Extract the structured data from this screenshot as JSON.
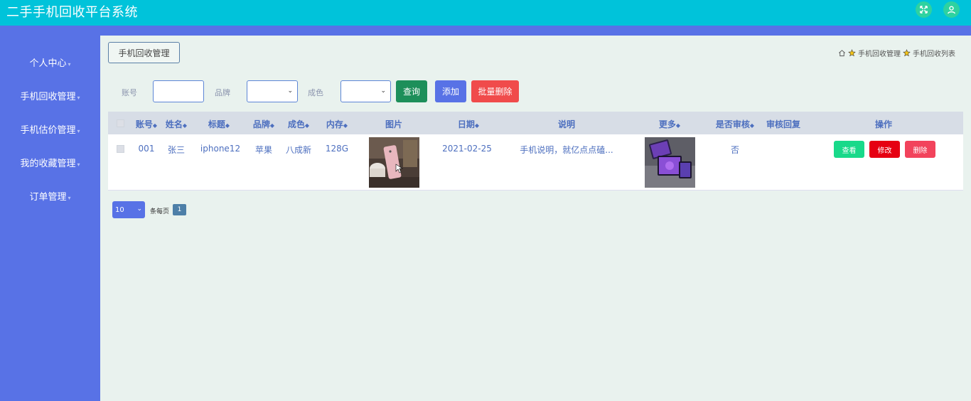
{
  "app": {
    "title": "二手手机回收平台系统"
  },
  "sidebar": {
    "items": [
      {
        "label": "个人中心"
      },
      {
        "label": "手机回收管理"
      },
      {
        "label": "手机估价管理"
      },
      {
        "label": "我的收藏管理"
      },
      {
        "label": "订单管理"
      }
    ]
  },
  "header": {
    "module_tag": "手机回收管理",
    "breadcrumb": [
      "手机回收管理",
      "手机回收列表"
    ]
  },
  "filters": {
    "account_label": "账号",
    "brand_label": "品牌",
    "condition_label": "成色",
    "account_value": "",
    "brand_value": "",
    "condition_value": ""
  },
  "actions": {
    "search": "查询",
    "add": "添加",
    "batch_delete": "批量删除"
  },
  "table": {
    "columns": [
      "账号",
      "姓名",
      "标题",
      "品牌",
      "成色",
      "内存",
      "图片",
      "日期",
      "说明",
      "更多",
      "是否审核",
      "审核回复",
      "操作"
    ],
    "rows": [
      {
        "account": "001",
        "name": "张三",
        "title": "iphone12",
        "brand": "苹果",
        "condition": "八成新",
        "memory": "128G",
        "date": "2021-02-25",
        "description": "手机说明，就亿点点磕...",
        "reviewed": "否",
        "review_reply": "",
        "buttons": {
          "view": "查看",
          "edit": "修改",
          "delete": "删除"
        }
      }
    ]
  },
  "pagination": {
    "page_size": "10",
    "per_page_label": "条每页",
    "current_page": "1"
  },
  "colors": {
    "topbar": "#00c3da",
    "sidebar": "#5872e6",
    "search": "#1d8f5a",
    "add": "#5872e6",
    "batch_delete": "#f04b4b",
    "view": "#19d98a",
    "edit": "#e60012",
    "delete": "#f2435c"
  }
}
